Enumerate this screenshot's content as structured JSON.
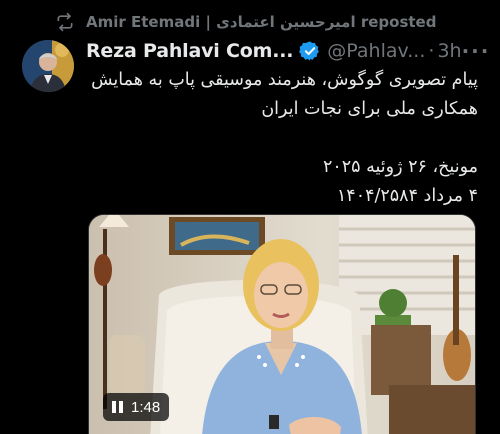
{
  "repost": {
    "icon": "repost-icon",
    "label": "Amir Etemadi | امیرحسین اعتمادی reposted"
  },
  "author": {
    "display_name": "Reza Pahlavi Com...",
    "handle": "@Pahlav...",
    "time": "3h",
    "verified_icon": "verified-badge-icon",
    "more_icon": "more-options-icon",
    "more_label": "···"
  },
  "tweet": {
    "line1": "پیام تصویری گوگوش، هنرمند موسیقی پاپ به همایش",
    "line2": "همکاری ملی برای نجات ایران",
    "line3": "مونیخ، ۲۶ ژوئیه ۲۰۲۵",
    "line4": "۴ مرداد ۱۴۰۴/۲۵۸۴"
  },
  "media": {
    "type": "video",
    "duration": "1:48",
    "control_icon": "pause-icon"
  },
  "colors": {
    "background": "#000000",
    "text": "#e7e9ea",
    "muted": "#71767b",
    "verified": "#1d9bf0"
  }
}
